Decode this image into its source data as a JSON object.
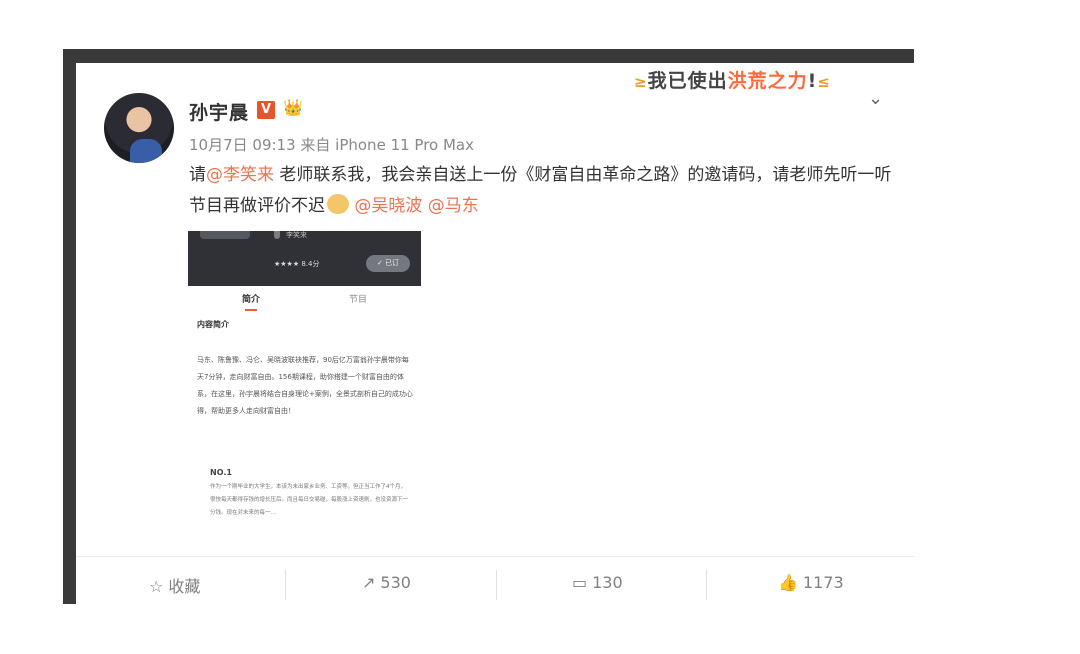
{
  "post": {
    "author": "孙宇晨",
    "badge": "V",
    "slogan_prefix": "我已使出",
    "slogan_highlight": "洪荒之力",
    "slogan_suffix": "!",
    "meta": "10月7日 09:13 来自 iPhone 11 Pro Max",
    "text": {
      "p1": "请",
      "m1": "@李笑来",
      "p2": " 老师联系我，我会亲自送上一份《财富自由革命之路》的邀请码，请老师先听一听节目再做评价不迟",
      "m2": " @吴晓波",
      "m3": " @马东"
    }
  },
  "screenshot": {
    "author": "李笑来",
    "rating": "★★★★ 8.4分",
    "subscribe": "✓ 已订",
    "tab_intro": "简介",
    "tab_episodes": "节目",
    "section_title": "内容简介",
    "body": "马东、陈鲁豫、冯仑、吴晓波联袂推荐，90后亿万富翁孙宇晨带你每天7分钟，走向财富自由。156期课程，助你搭建一个财富自由的体系，在这里，孙宇晨将结合自身理论+案例，全景式剖析自己的成功心得，帮助更多人走向财富自由！",
    "no": "NO.1",
    "small": "作为一个刚毕业的大学生，本该为未出家乡业务、工资等。但正当工作了4个月，很快每天都得存钱的增长压后。而且每日交易碰，每股涨上资速刷，也没资源下一分钱。现在对未来的每一…"
  },
  "actions": {
    "favorite": "收藏",
    "repost": "530",
    "comment": "130",
    "like": "1173"
  },
  "icons": {
    "favorite": "star-outline-icon",
    "repost": "share-icon",
    "comment": "comment-icon",
    "like": "thumbs-up-icon",
    "menu": "chevron-down-icon"
  }
}
